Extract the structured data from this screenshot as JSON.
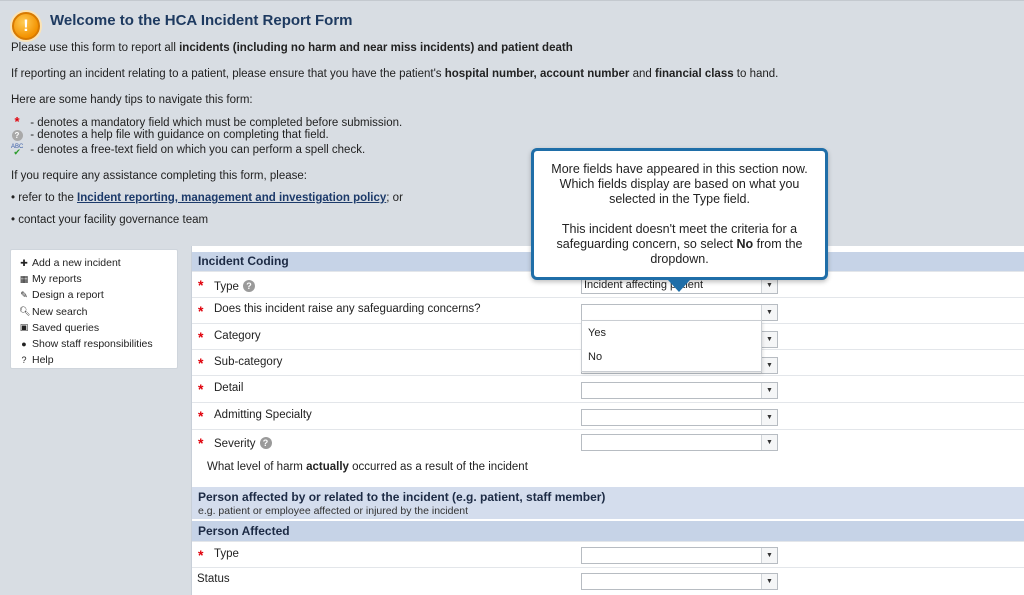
{
  "header": {
    "title": "Welcome to the HCA Incident Report Form",
    "intro_pre": "Please use this form to report all ",
    "intro_bold": "incidents (including no harm and near miss incidents) and patient death",
    "patient_pre": "If reporting an incident relating to a patient, please ensure that you have the patient's ",
    "patient_bold1": "hospital number, account number",
    "patient_mid": " and ",
    "patient_bold2": "financial class",
    "patient_post": " to hand.",
    "tips_intro": "Here are some handy tips to navigate this form:",
    "legend_mandatory": " - denotes a mandatory field which must be completed before submission.",
    "legend_help": " - denotes a help file with guidance on completing that field.",
    "legend_spell": " - denotes a free-text field on which you can perform a spell check.",
    "assist_intro": "If you require any assistance completing this form, please:",
    "bullet1_pre": "• refer to the ",
    "bullet1_link": "Incident reporting, management and investigation policy",
    "bullet1_post": "; or",
    "bullet2": "• contact your facility governance team"
  },
  "sidebar": {
    "items": [
      {
        "label": "Add a new incident",
        "icon": "plus-icon"
      },
      {
        "label": "My reports",
        "icon": "reports-icon"
      },
      {
        "label": "Design a report",
        "icon": "pencil-icon"
      },
      {
        "label": "New search",
        "icon": "search-icon"
      },
      {
        "label": "Saved queries",
        "icon": "saved-icon"
      },
      {
        "label": "Show staff responsibilities",
        "icon": "person-icon"
      },
      {
        "label": "Help",
        "icon": "question-icon"
      }
    ]
  },
  "form": {
    "incident_coding_title": "Incident Coding",
    "fields": {
      "type": {
        "label": "Type",
        "value": "Incident affecting patient"
      },
      "safeguarding": {
        "label": "Does this incident raise any safeguarding concerns?",
        "value": ""
      },
      "category": {
        "label": "Category",
        "value": ""
      },
      "subcategory": {
        "label": "Sub-category",
        "value": ""
      },
      "detail": {
        "label": "Detail",
        "value": ""
      },
      "specialty": {
        "label": "Admitting Specialty",
        "value": ""
      },
      "severity": {
        "label": "Severity",
        "value": ""
      }
    },
    "severity_note_pre": "What level of harm ",
    "severity_note_bold": "actually",
    "severity_note_post": " occurred as a result of the incident",
    "person_section_title": "Person affected by or related to the incident (e.g. patient, staff member)",
    "person_section_sub": "e.g. patient or employee affected or injured by the incident",
    "person_affected_title": "Person Affected",
    "person_type_label": "Type",
    "person_type_value": "",
    "status_label": "Status",
    "status_value": ""
  },
  "dropdown": {
    "options": [
      "Yes",
      "No"
    ]
  },
  "callout": {
    "para1": "More fields have appeared in this section now. Which fields display are based on what you selected in the Type field.",
    "para2_pre": "This incident doesn't meet the criteria for a safeguarding concern, so select ",
    "para2_bold": "No",
    "para2_post": " from the dropdown."
  },
  "colors": {
    "section_header": "#c6d3e7",
    "callout_border": "#1f6ea8",
    "mandatory_star": "#e0000a",
    "warning_icon": "#f39200"
  }
}
